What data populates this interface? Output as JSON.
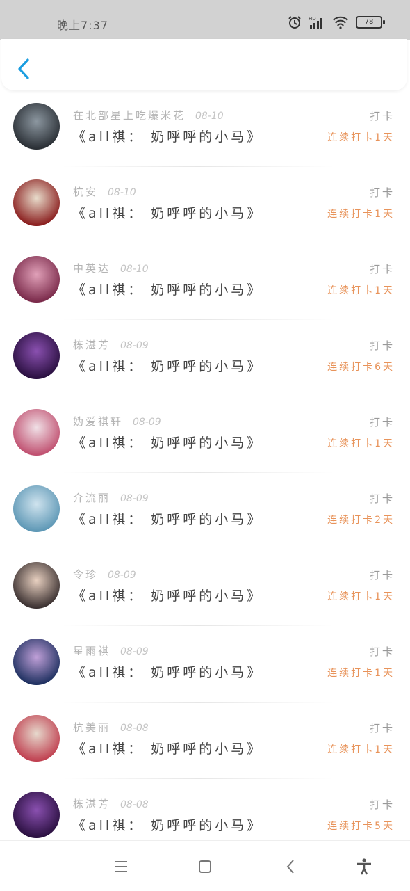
{
  "status_bar": {
    "time": "晚上7:37",
    "battery": "78",
    "icons": [
      "alarm-icon",
      "hd-signal-icon",
      "wifi-icon",
      "battery-icon"
    ]
  },
  "header": {
    "back_icon": "chevron-left-icon",
    "accent_color": "#1a9de0"
  },
  "records": [
    {
      "name": "在北部星上吃爆米花",
      "date": "08-10",
      "book": "《all祺： 奶呼呼的小马》",
      "tag": "打卡",
      "streak": "连续打卡1天",
      "avatar_colors": [
        "#2a2f35",
        "#8c97a0"
      ]
    },
    {
      "name": "杭安",
      "date": "08-10",
      "book": "《all祺： 奶呼呼的小马》",
      "tag": "打卡",
      "streak": "连续打卡1天",
      "avatar_colors": [
        "#8a1e1e",
        "#e8dccb"
      ]
    },
    {
      "name": "中英达",
      "date": "08-10",
      "book": "《all祺： 奶呼呼的小马》",
      "tag": "打卡",
      "streak": "连续打卡1天",
      "avatar_colors": [
        "#7a2a4a",
        "#e0a0b8"
      ]
    },
    {
      "name": "栋湛芳",
      "date": "08-09",
      "book": "《all祺： 奶呼呼的小马》",
      "tag": "打卡",
      "streak": "连续打卡6天",
      "avatar_colors": [
        "#2a1040",
        "#8a50b0"
      ]
    },
    {
      "name": "妫爱祺轩",
      "date": "08-09",
      "book": "《all祺： 奶呼呼的小马》",
      "tag": "打卡",
      "streak": "连续打卡1天",
      "avatar_colors": [
        "#c05070",
        "#f0e0e6"
      ]
    },
    {
      "name": "介流丽",
      "date": "08-09",
      "book": "《all祺： 奶呼呼的小马》",
      "tag": "打卡",
      "streak": "连续打卡2天",
      "avatar_colors": [
        "#5d97b5",
        "#cfe3ee"
      ]
    },
    {
      "name": "令珍",
      "date": "08-09",
      "book": "《all祺： 奶呼呼的小马》",
      "tag": "打卡",
      "streak": "连续打卡1天",
      "avatar_colors": [
        "#3a3030",
        "#e8d0c0"
      ]
    },
    {
      "name": "星雨祺",
      "date": "08-09",
      "book": "《all祺： 奶呼呼的小马》",
      "tag": "打卡",
      "streak": "连续打卡1天",
      "avatar_colors": [
        "#1e3060",
        "#c0a0d8"
      ]
    },
    {
      "name": "杭美丽",
      "date": "08-08",
      "book": "《all祺： 奶呼呼的小马》",
      "tag": "打卡",
      "streak": "连续打卡1天",
      "avatar_colors": [
        "#c04050",
        "#e6d8cc"
      ]
    },
    {
      "name": "栋湛芳",
      "date": "08-08",
      "book": "《all祺： 奶呼呼的小马》",
      "tag": "打卡",
      "streak": "连续打卡5天",
      "avatar_colors": [
        "#2a1040",
        "#8a50b0"
      ]
    }
  ],
  "colors": {
    "streak": "#e8935a",
    "name": "#b4b4b4",
    "book": "#444444"
  },
  "nav_bar": {
    "icons": [
      "menu-icon",
      "home-icon",
      "back-icon",
      "accessibility-icon"
    ]
  }
}
